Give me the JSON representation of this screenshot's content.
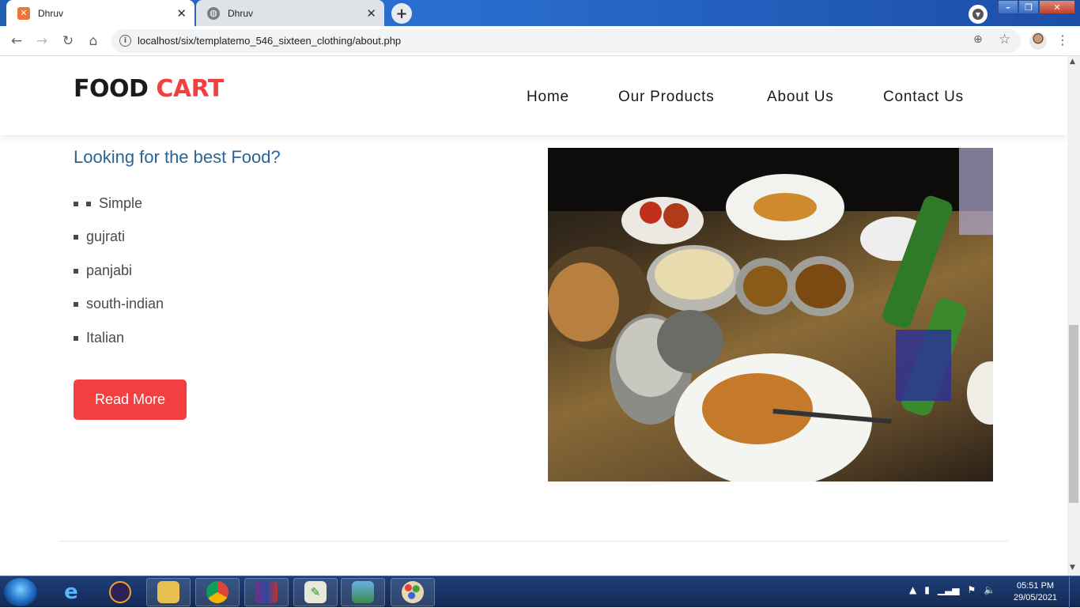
{
  "browser": {
    "tabs": [
      {
        "title": "Dhruv",
        "active": true,
        "icon": "xampp-icon"
      },
      {
        "title": "Dhruv",
        "active": false,
        "icon": "globe-icon"
      }
    ],
    "url": "localhost/six/templatemo_546_sixteen_clothing/about.php"
  },
  "site": {
    "logo_part1": "FOOD",
    "logo_part2": "CART",
    "nav": [
      "Home",
      "Our Products",
      "About Us",
      "Contact Us"
    ],
    "heading": "Looking for the best Food?",
    "list": [
      "Simple",
      "gujrati",
      "panjabi",
      "south-indian",
      "Italian"
    ],
    "read_more": "Read More",
    "image_alt": "Indian food table spread",
    "colors": {
      "accent": "#f33f3f",
      "heading": "#2a6496"
    }
  },
  "taskbar": {
    "time": "05:51 PM",
    "date": "29/05/2021",
    "apps": [
      "internet-explorer",
      "eclipse",
      "file-explorer",
      "chrome",
      "winrar",
      "notepad",
      "photos",
      "paint"
    ]
  }
}
